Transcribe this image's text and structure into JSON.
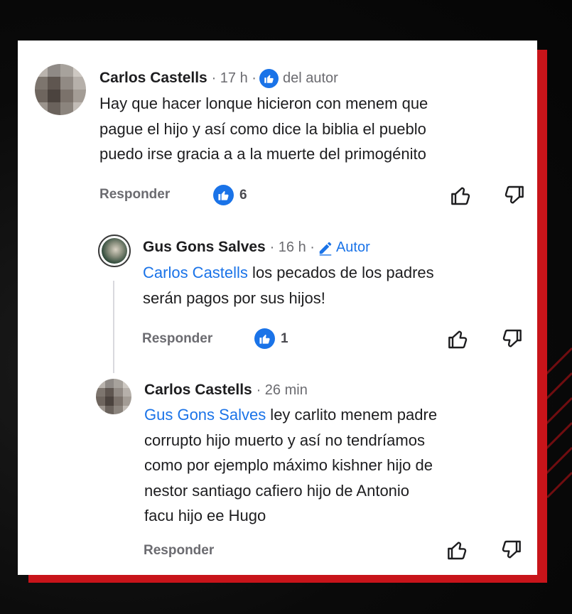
{
  "comments": [
    {
      "author": "Carlos Castells",
      "time": "· 17 h ·",
      "badge": "del autor",
      "text_lines": [
        "Hay que hacer lonque hicieron con menem que",
        "pague el hijo y así como dice la biblia el pueblo",
        "puedo irse gracia a a la muerte del primogénito"
      ],
      "reply_label": "Responder",
      "like_count": "6"
    },
    {
      "author": "Gus Gons Salves",
      "time": "· 16 h ·",
      "badge": "Autor",
      "mention": "Carlos Castells",
      "text_first": " los pecados de los padres",
      "text_lines": [
        "serán pagos por sus hijos!"
      ],
      "reply_label": "Responder",
      "like_count": "1"
    },
    {
      "author": "Carlos Castells",
      "time": "· 26 min",
      "mention": "Gus Gons Salves",
      "text_first": " ley carlito menem padre",
      "text_lines": [
        "corrupto hijo muerto y así no tendríamos",
        "como por ejemplo máximo kishner hijo de",
        "nestor santiago cafiero hijo de Antonio",
        "facu hijo ee Hugo"
      ],
      "reply_label": "Responder"
    }
  ],
  "colors": {
    "accent": "#1a73e8",
    "frame": "#c8141a"
  },
  "icons": [
    "thumbs-up-icon",
    "thumbs-down-icon",
    "like-badge-icon",
    "pencil-icon"
  ]
}
